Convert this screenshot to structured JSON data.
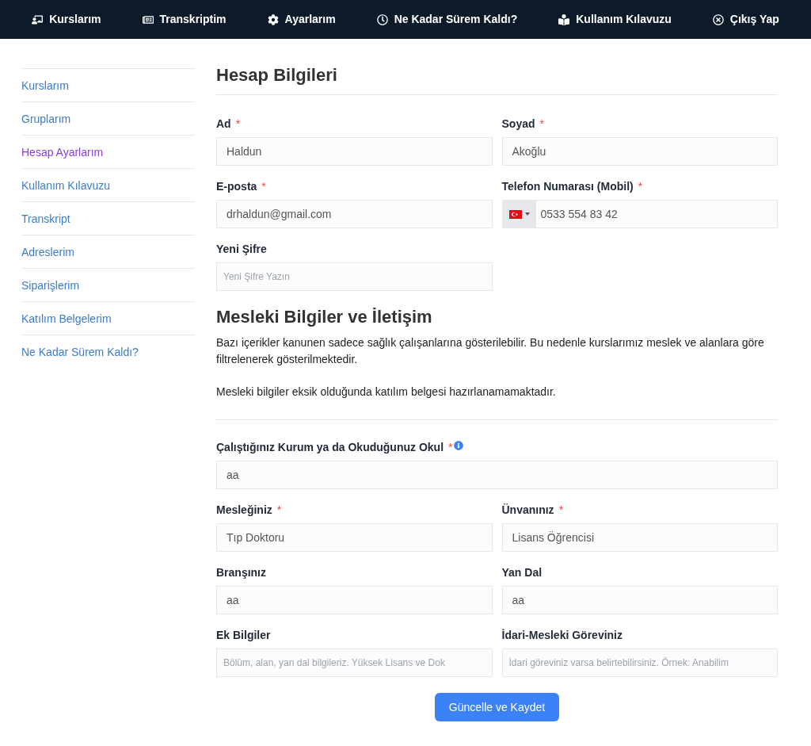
{
  "top_nav": [
    {
      "label": "Kurslarım"
    },
    {
      "label": "Transkriptim"
    },
    {
      "label": "Ayarlarım"
    },
    {
      "label": "Ne Kadar Sürem Kaldı?"
    },
    {
      "label": "Kullanım Kılavuzu"
    },
    {
      "label": "Çıkış Yap"
    }
  ],
  "sidebar": {
    "items": [
      {
        "label": "Kurslarım",
        "selected": false
      },
      {
        "label": "Gruplarım",
        "selected": false
      },
      {
        "label": "Hesap Ayarlarım",
        "selected": true
      },
      {
        "label": "Kullanım Kılavuzu",
        "selected": false
      },
      {
        "label": "Transkript",
        "selected": false
      },
      {
        "label": "Adreslerim",
        "selected": false
      },
      {
        "label": "Siparişlerim",
        "selected": false
      },
      {
        "label": "Katılım Belgelerim",
        "selected": false
      },
      {
        "label": "Ne Kadar Sürem Kaldı?",
        "selected": false
      }
    ]
  },
  "account": {
    "title": "Hesap Bilgileri",
    "rows": [
      [
        {
          "label": "Ad",
          "required_mark": "*",
          "kind": "text",
          "value": "Haldun"
        },
        {
          "label": "Soyad",
          "required_mark": "*",
          "kind": "text",
          "value": "Akoğlu"
        }
      ],
      [
        {
          "label": "E-posta",
          "required_mark": "*",
          "kind": "text",
          "value": "drhaldun@gmail.com"
        },
        {
          "label": "Telefon Numarası (Mobil)",
          "required_mark": "*",
          "kind": "phone",
          "value": "0533 554 83 42"
        }
      ],
      [
        {
          "label": "Yeni Şifre",
          "kind": "text",
          "placeholder": "Yeni Şifre Yazın"
        }
      ]
    ]
  },
  "professional": {
    "title": "Mesleki Bilgiler ve İletişim",
    "paragraphs": [
      "Bazı içerikler kanunen sadece sağlık çalışanlarına gösterilebilir. Bu nedenle kurslarımız meslek ve alanlara göre filtrelenerek gösterilmektedir.",
      "Mesleki bilgiler eksik olduğunda katılım belgesi hazırlanamamaktadır."
    ],
    "rows": [
      [
        {
          "label": "Çalıştığınız Kurum ya da Okuduğunuz Okul",
          "required_mark": "*",
          "info": true,
          "kind": "text",
          "value": "aa"
        }
      ],
      [
        {
          "label": "Mesleğiniz",
          "required_mark": "*",
          "kind": "text",
          "value": "Tıp Doktoru"
        },
        {
          "label": "Ünvanınız",
          "required_mark": "*",
          "kind": "text",
          "value": "Lisans Öğrencisi"
        }
      ],
      [
        {
          "label": "Branşınız",
          "kind": "text",
          "value": "aa"
        },
        {
          "label": "Yan Dal",
          "kind": "text",
          "value": "aa"
        }
      ],
      [
        {
          "label": "Ek Bilgiler",
          "kind": "text",
          "placeholder": "Bölüm, alan, yan dal bilgileriz. Yüksek Lisans ve Dok"
        },
        {
          "label": "İdari-Mesleki Göreviniz",
          "kind": "text",
          "placeholder": "İdari göreviniz varsa belirtebilirsiniz. Örnek: Anabilim"
        }
      ]
    ]
  },
  "submit_button": "Güncelle ve Kaydet"
}
